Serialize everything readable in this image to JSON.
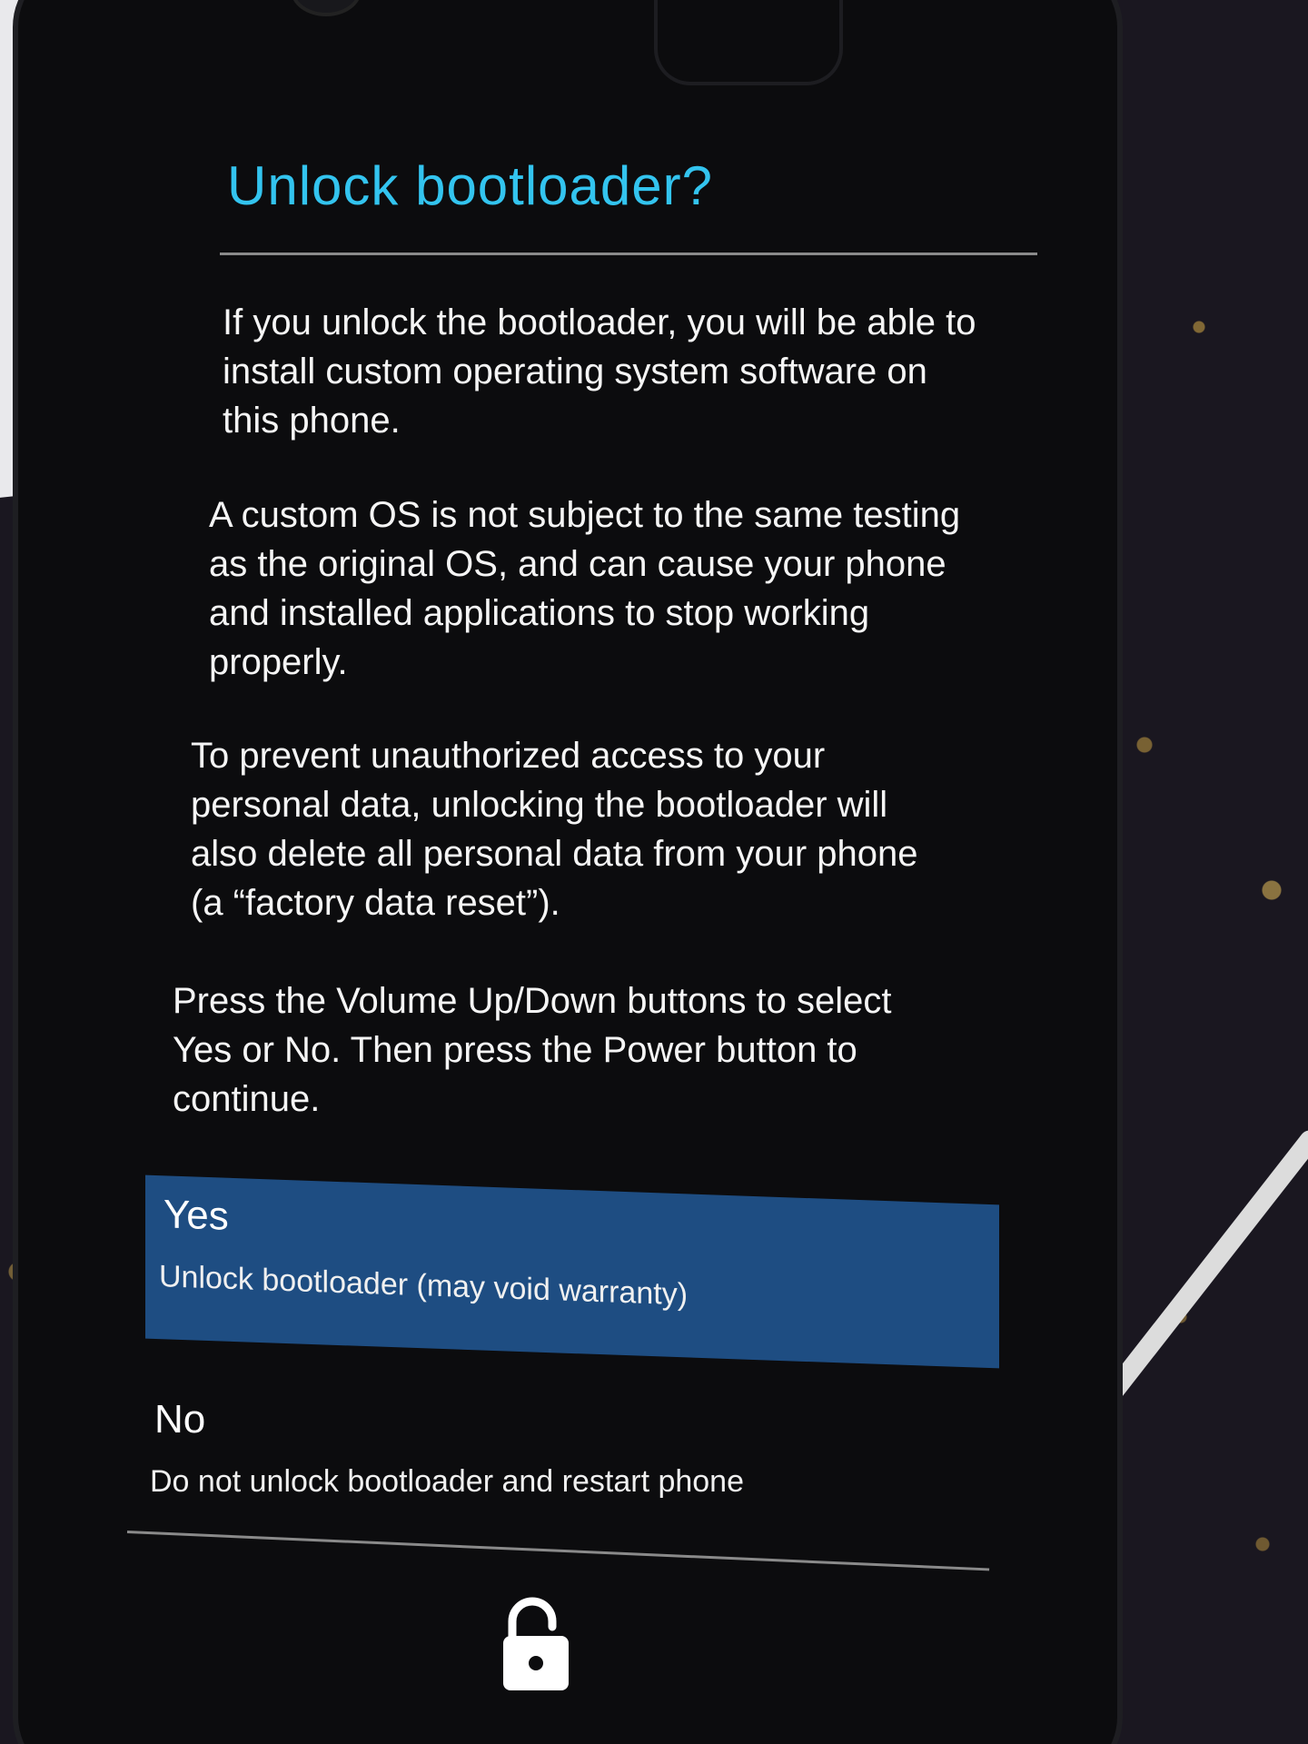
{
  "dialog": {
    "title": "Unlock bootloader?",
    "paragraphs": [
      "If you unlock the bootloader, you will be able to install custom operating system software on this phone.",
      "A custom OS is not subject to the same testing as the original OS, and can cause your phone and installed applications to stop working properly.",
      "To prevent unauthorized access to your personal data, unlocking the bootloader will also delete all personal data from your phone (a “factory data reset”).",
      "Press the Volume Up/Down buttons to select Yes or No. Then press the Power button to continue."
    ],
    "options": [
      {
        "title": "Yes",
        "subtitle": "Unlock bootloader (may void warranty)",
        "selected": true
      },
      {
        "title": "No",
        "subtitle": "Do not unlock bootloader and restart phone",
        "selected": false
      }
    ]
  },
  "icons": {
    "footer": "unlocked-padlock-icon"
  },
  "colors": {
    "title": "#33c4ef",
    "selected_option": "#1e4d82",
    "screen_background": "#0c0c0e",
    "text": "#f5f5f5"
  }
}
